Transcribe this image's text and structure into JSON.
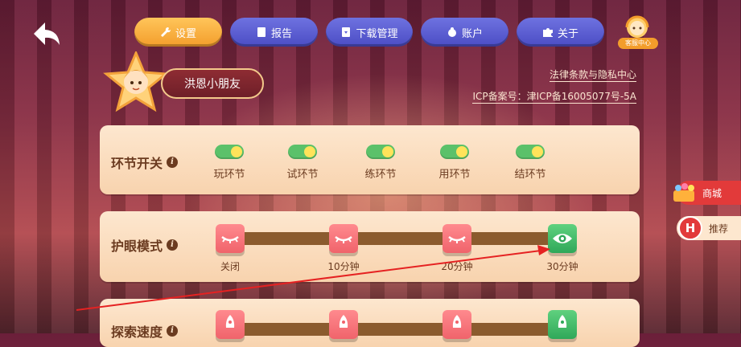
{
  "tabs": [
    {
      "label": "设置",
      "icon": "wrench-icon",
      "active": true
    },
    {
      "label": "报告",
      "icon": "document-icon",
      "active": false
    },
    {
      "label": "下载管理",
      "icon": "download-icon",
      "active": false
    },
    {
      "label": "账户",
      "icon": "bag-icon",
      "active": false
    },
    {
      "label": "关于",
      "icon": "puzzle-icon",
      "active": false
    }
  ],
  "service": {
    "label": "客服中心"
  },
  "profile": {
    "name": "洪恩小朋友"
  },
  "legal": {
    "link": "法律条款与隐私中心",
    "icp": "ICP备案号：津ICP备16005077号-5A"
  },
  "sections": {
    "stages": {
      "title": "环节开关",
      "items": [
        "玩环节",
        "试环节",
        "练环节",
        "用环节",
        "结环节"
      ],
      "state": "on"
    },
    "eye": {
      "title": "护眼模式",
      "options": [
        "关闭",
        "10分钟",
        "20分钟",
        "30分钟"
      ],
      "selected_index": 3
    },
    "speed": {
      "title": "探索速度"
    }
  },
  "side": {
    "shop": "商城",
    "recommend": "推荐"
  },
  "colors": {
    "accent": "#f39d2b",
    "tab": "#5b5ed6",
    "on": "#5bc16a",
    "red": "#f0636b",
    "green": "#2fa859",
    "annotation": "#e52222"
  }
}
